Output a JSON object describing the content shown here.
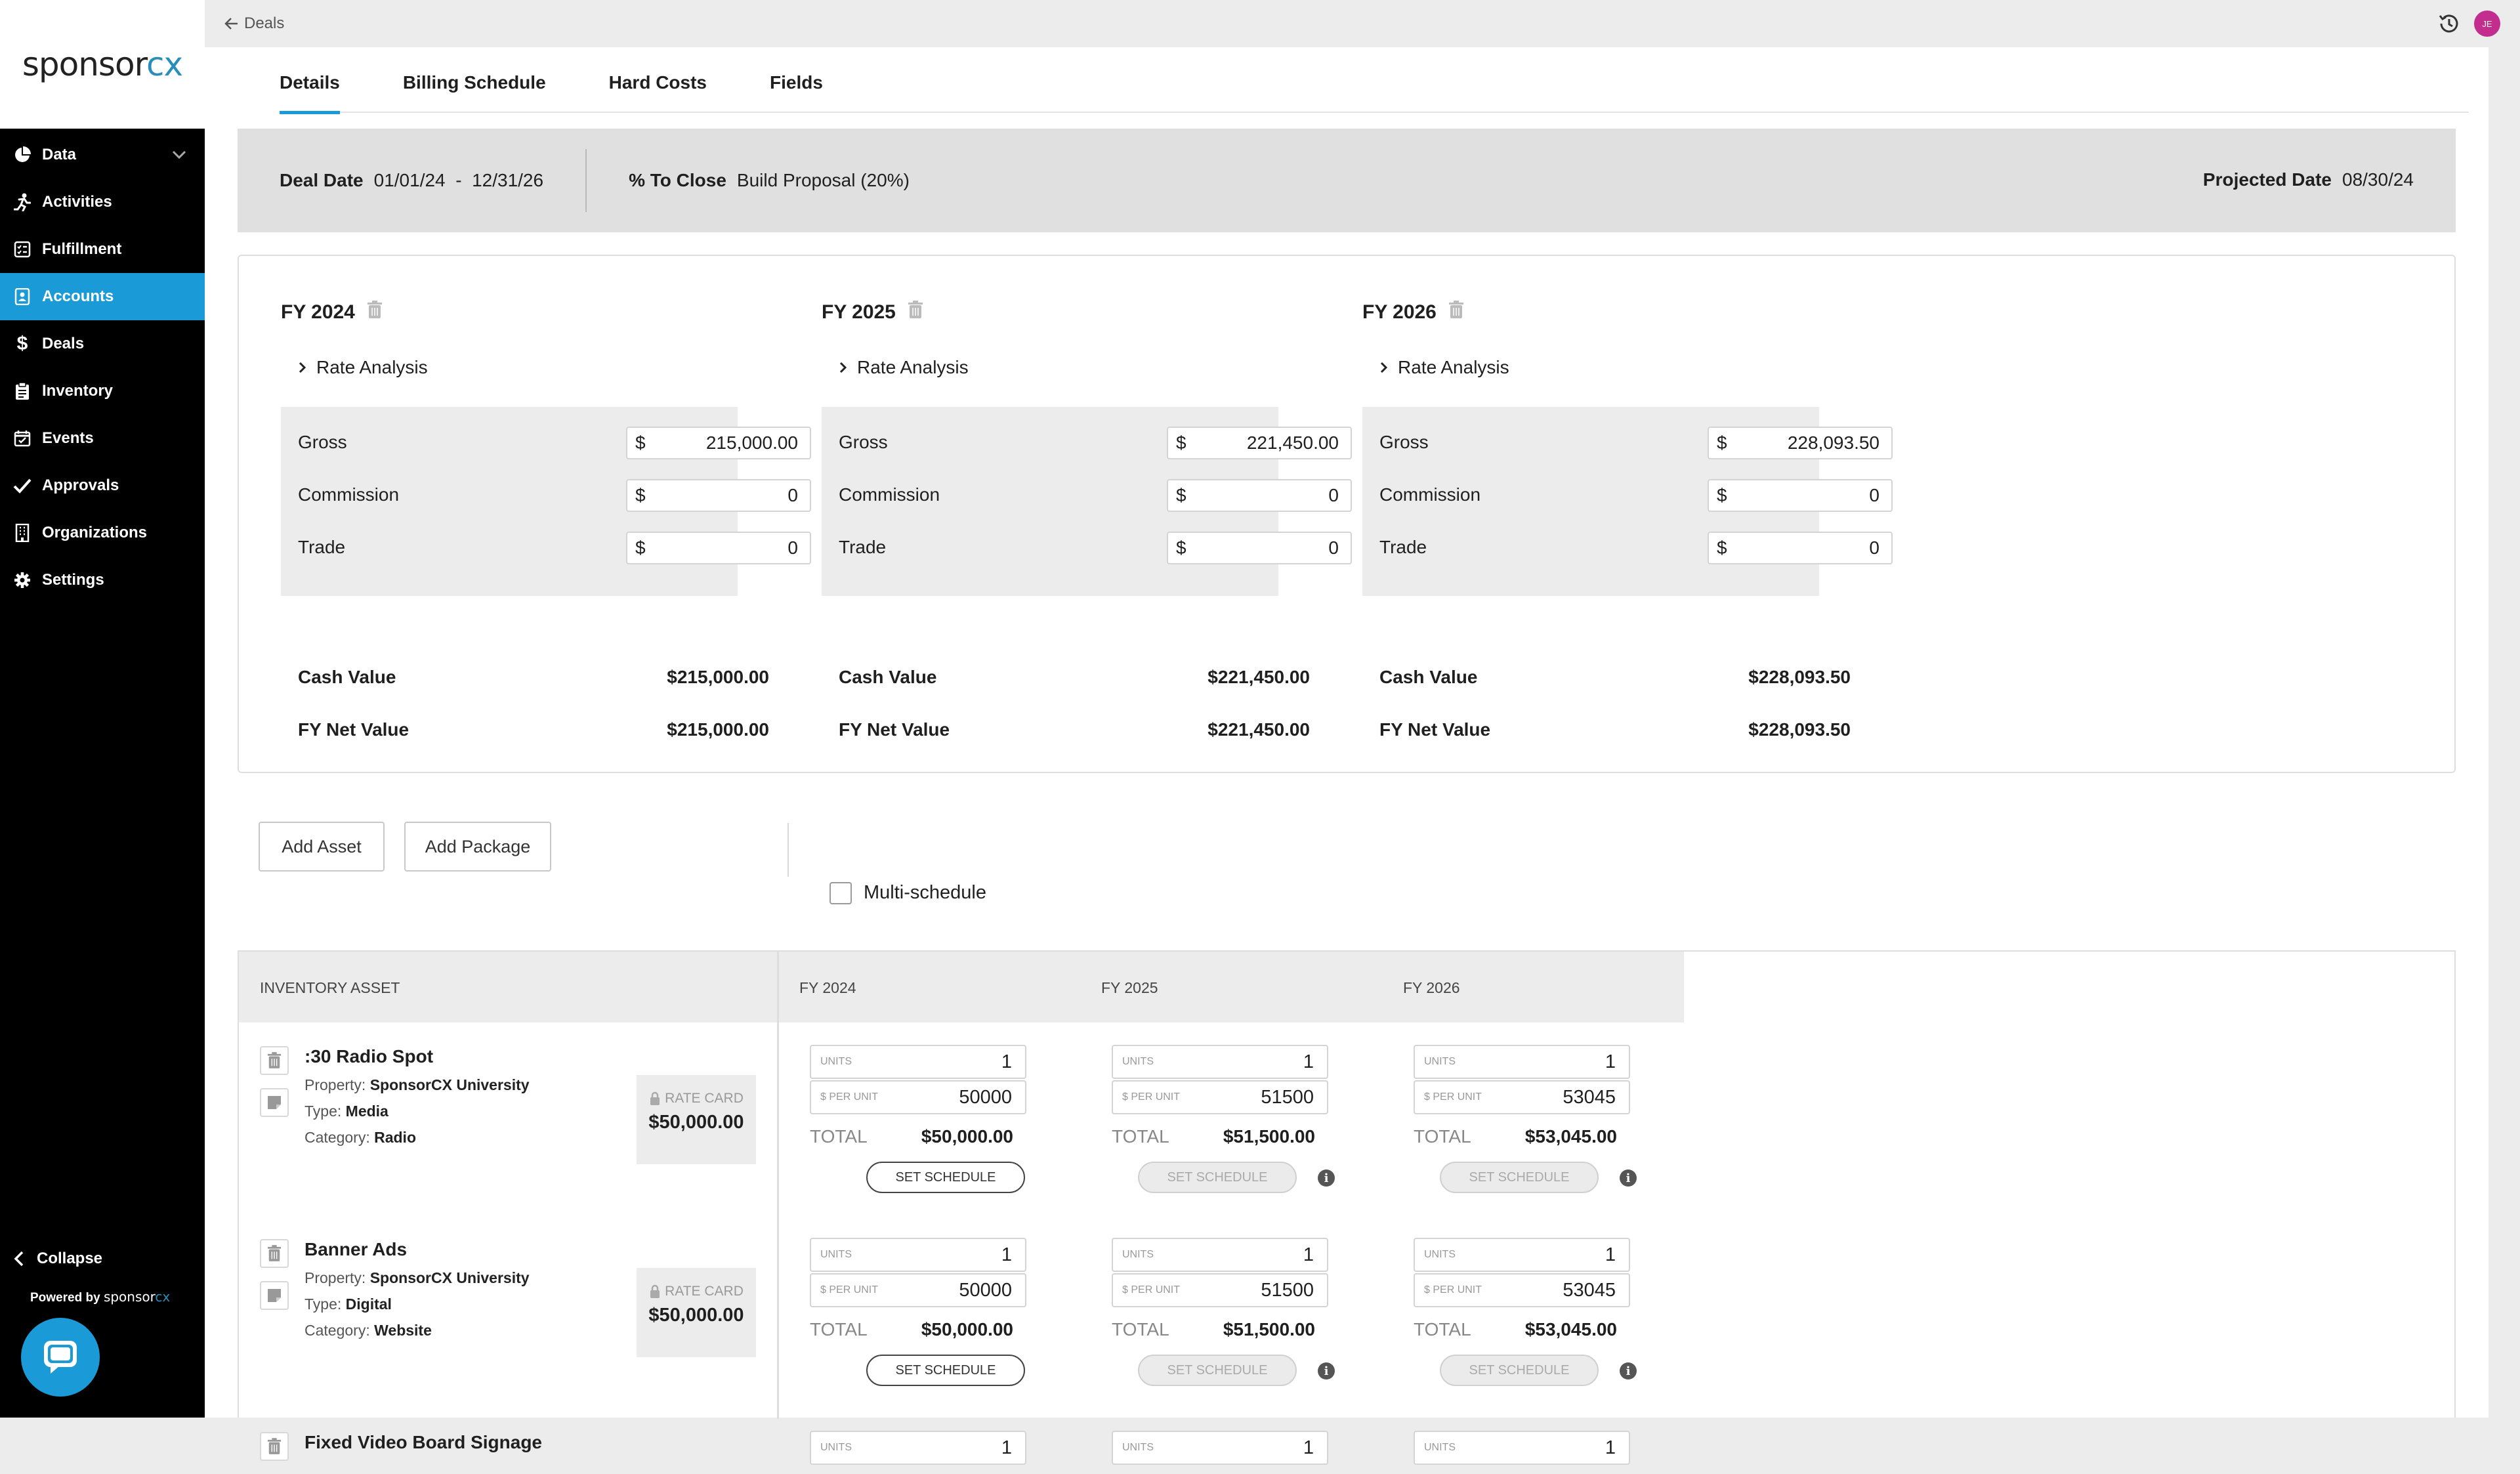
{
  "sidebar": {
    "logo_main": "sponsor",
    "logo_accent": "cx",
    "items": [
      {
        "label": "Data",
        "icon": "pie-chart-icon"
      },
      {
        "label": "Activities",
        "icon": "running-person-icon"
      },
      {
        "label": "Fulfillment",
        "icon": "checklist-icon"
      },
      {
        "label": "Accounts",
        "icon": "address-book-icon",
        "active": true
      },
      {
        "label": "Deals",
        "icon": "dollar-icon"
      },
      {
        "label": "Inventory",
        "icon": "clipboard-icon"
      },
      {
        "label": "Events",
        "icon": "calendar-check-icon"
      },
      {
        "label": "Approvals",
        "icon": "check-icon"
      },
      {
        "label": "Organizations",
        "icon": "building-icon"
      },
      {
        "label": "Settings",
        "icon": "gear-icon"
      }
    ],
    "collapse_label": "Collapse",
    "powered_by": "Powered by",
    "powered_logo_main": "sponsor",
    "powered_logo_accent": "cx"
  },
  "topbar": {
    "back_label": "Deals",
    "avatar_initials": "JE"
  },
  "tabs": [
    "Details",
    "Billing Schedule",
    "Hard Costs",
    "Fields"
  ],
  "deal": {
    "date_label": "Deal Date",
    "start": "01/01/24",
    "separator": "-",
    "end": "12/31/26",
    "close_label": "% To Close",
    "close_value": "Build Proposal (20%)",
    "projected_label": "Projected Date",
    "projected_value": "08/30/24"
  },
  "fiscal_years": [
    {
      "title": "FY 2024",
      "rate_analysis": "Rate Analysis",
      "gross_label": "Gross",
      "gross": "215,000.00",
      "commission_label": "Commission",
      "commission": "0",
      "trade_label": "Trade",
      "trade": "0",
      "currency": "$",
      "cash_label": "Cash Value",
      "cash_value": "$215,000.00",
      "net_label": "FY Net Value",
      "net_value": "$215,000.00"
    },
    {
      "title": "FY 2025",
      "rate_analysis": "Rate Analysis",
      "gross_label": "Gross",
      "gross": "221,450.00",
      "commission_label": "Commission",
      "commission": "0",
      "trade_label": "Trade",
      "trade": "0",
      "currency": "$",
      "cash_label": "Cash Value",
      "cash_value": "$221,450.00",
      "net_label": "FY Net Value",
      "net_value": "$221,450.00"
    },
    {
      "title": "FY 2026",
      "rate_analysis": "Rate Analysis",
      "gross_label": "Gross",
      "gross": "228,093.50",
      "commission_label": "Commission",
      "commission": "0",
      "trade_label": "Trade",
      "trade": "0",
      "currency": "$",
      "cash_label": "Cash Value",
      "cash_value": "$228,093.50",
      "net_label": "FY Net Value",
      "net_value": "$228,093.50"
    }
  ],
  "actions": {
    "add_asset": "Add Asset",
    "add_package": "Add Package",
    "multi_schedule": "Multi-schedule"
  },
  "inventory": {
    "header_asset": "INVENTORY ASSET",
    "header_years": [
      "FY 2024",
      "FY 2025",
      "FY 2026"
    ],
    "rate_card_label": "RATE CARD",
    "units_label": "UNITS",
    "per_unit_label": "$ PER UNIT",
    "total_label": "TOTAL",
    "set_schedule_label": "SET SCHEDULE",
    "property_label": "Property:",
    "type_label": "Type:",
    "category_label": "Category:",
    "rows": [
      {
        "name": ":30 Radio Spot",
        "property": "SponsorCX University",
        "type": "Media",
        "category": "Radio",
        "rate_card": "$50,000.00",
        "years": [
          {
            "units": "1",
            "per_unit": "50000",
            "total": "$50,000.00"
          },
          {
            "units": "1",
            "per_unit": "51500",
            "total": "$51,500.00"
          },
          {
            "units": "1",
            "per_unit": "53045",
            "total": "$53,045.00"
          }
        ]
      },
      {
        "name": "Banner Ads",
        "property": "SponsorCX University",
        "type": "Digital",
        "category": "Website",
        "rate_card": "$50,000.00",
        "years": [
          {
            "units": "1",
            "per_unit": "50000",
            "total": "$50,000.00"
          },
          {
            "units": "1",
            "per_unit": "51500",
            "total": "$51,500.00"
          },
          {
            "units": "1",
            "per_unit": "53045",
            "total": "$53,045.00"
          }
        ]
      },
      {
        "name": "Fixed Video Board Signage",
        "years": [
          {
            "units": "1"
          },
          {
            "units": "1"
          },
          {
            "units": "1"
          }
        ]
      }
    ]
  }
}
